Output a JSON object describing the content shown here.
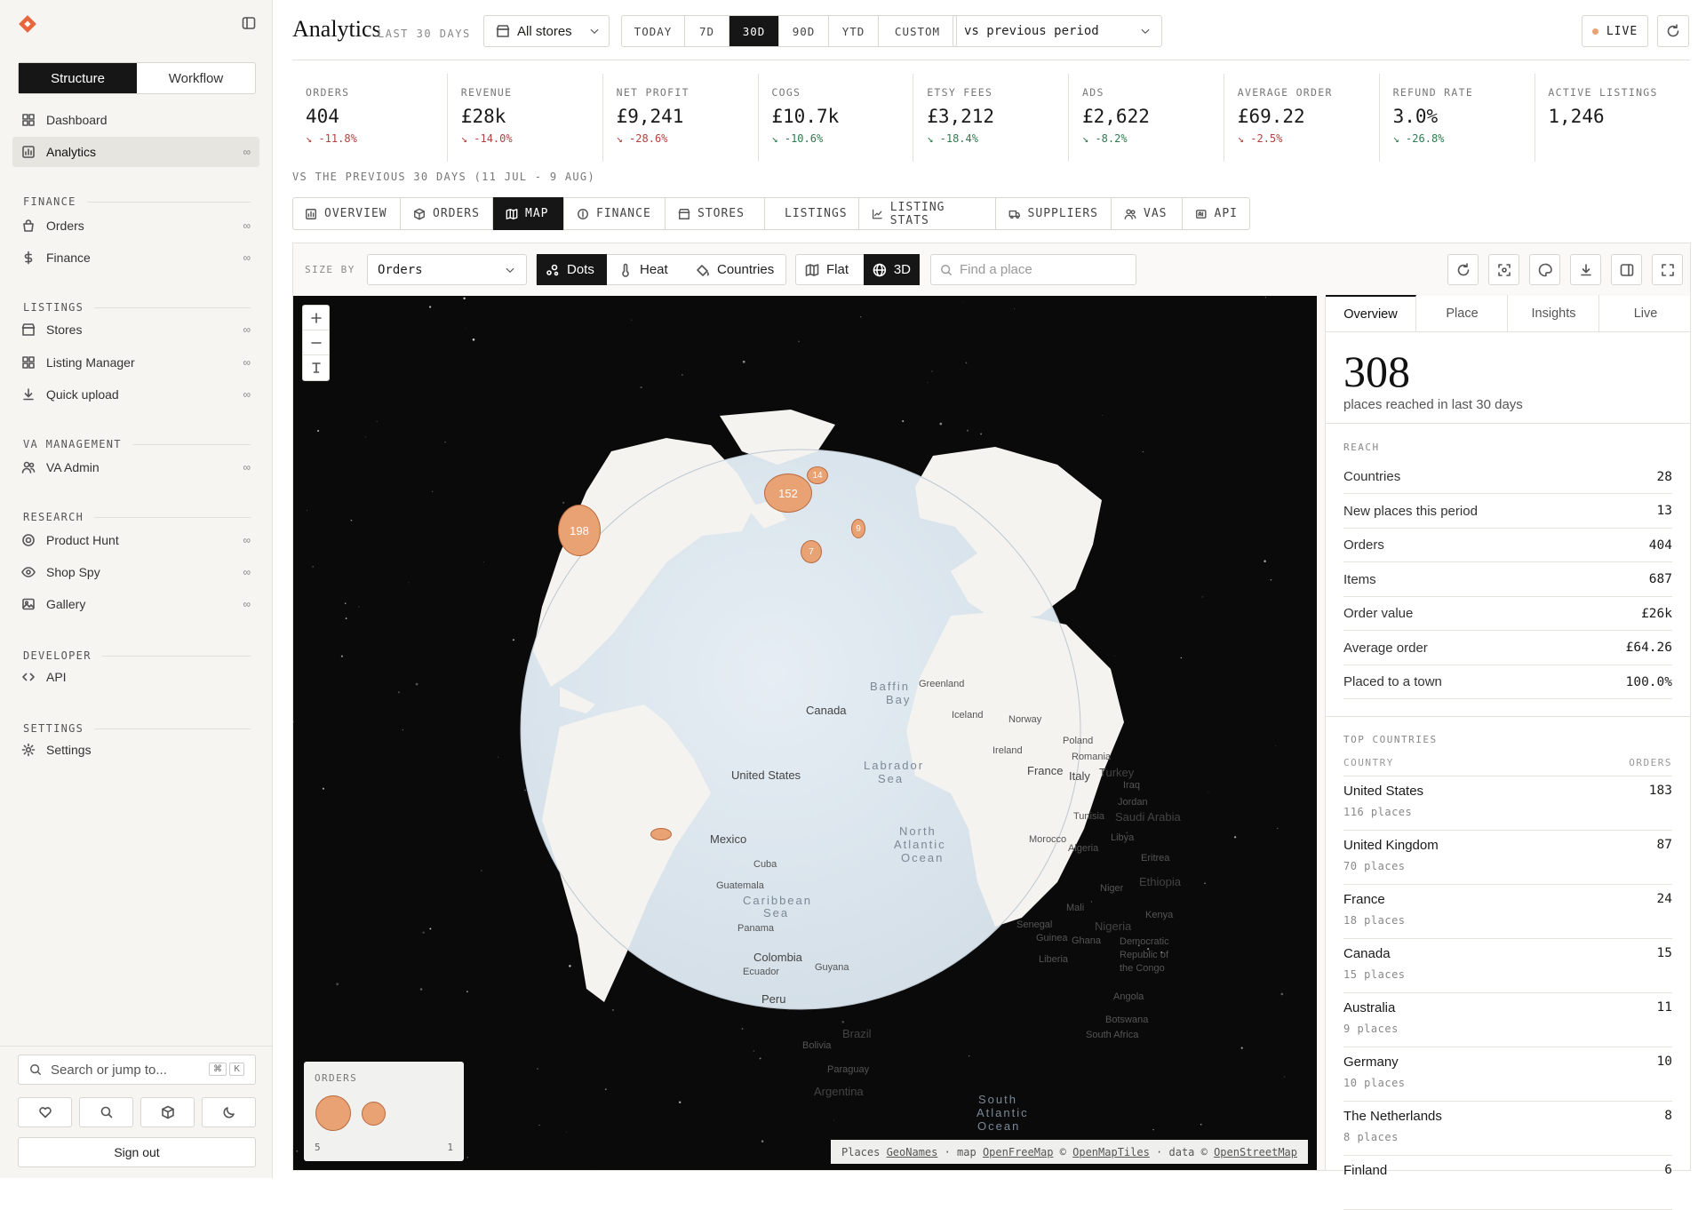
{
  "sidebar": {
    "mode_tabs": [
      "Structure",
      "Workflow"
    ],
    "top_items": [
      {
        "label": "Dashboard",
        "icon": "grid-icon"
      },
      {
        "label": "Analytics",
        "icon": "chart-icon",
        "badge": "∞",
        "active": true
      }
    ],
    "sections": [
      {
        "title": "FINANCE",
        "items": [
          {
            "label": "Orders",
            "icon": "bag-icon",
            "badge": "∞"
          },
          {
            "label": "Finance",
            "icon": "dollar-icon",
            "badge": "∞"
          }
        ]
      },
      {
        "title": "LISTINGS",
        "items": [
          {
            "label": "Stores",
            "icon": "store-icon",
            "badge": "∞"
          },
          {
            "label": "Listing Manager",
            "icon": "grid-icon",
            "badge": "∞"
          },
          {
            "label": "Quick upload",
            "icon": "download-icon",
            "badge": "∞"
          }
        ]
      },
      {
        "title": "VA MANAGEMENT",
        "items": [
          {
            "label": "VA Admin",
            "icon": "users-icon",
            "badge": "∞"
          }
        ]
      },
      {
        "title": "RESEARCH",
        "items": [
          {
            "label": "Product Hunt",
            "icon": "target-icon",
            "badge": "∞"
          },
          {
            "label": "Shop Spy",
            "icon": "eye-icon",
            "badge": "∞"
          },
          {
            "label": "Gallery",
            "icon": "image-icon",
            "badge": "∞"
          }
        ]
      },
      {
        "title": "DEVELOPER",
        "items": [
          {
            "label": "API",
            "icon": "code-icon"
          }
        ]
      },
      {
        "title": "SETTINGS",
        "items": [
          {
            "label": "Settings",
            "icon": "gear-icon"
          }
        ]
      }
    ],
    "search_placeholder": "Search or jump to...",
    "shortcut": [
      "⌘",
      "K"
    ],
    "signout": "Sign out"
  },
  "header": {
    "title": "Analytics",
    "subtitle": "LAST 30 DAYS",
    "store_select": "All stores",
    "ranges": [
      "TODAY",
      "7D",
      "30D",
      "90D",
      "YTD",
      "CUSTOM"
    ],
    "active_range": "30D",
    "compare": "vs previous period",
    "live": "LIVE"
  },
  "kpis": [
    {
      "label": "ORDERS",
      "value": "404",
      "delta": "↘ -11.8%",
      "dir": "up"
    },
    {
      "label": "REVENUE",
      "value": "£28k",
      "delta": "↘ -14.0%",
      "dir": "up"
    },
    {
      "label": "NET PROFIT",
      "value": "£9,241",
      "delta": "↘ -28.6%",
      "dir": "up"
    },
    {
      "label": "COGS",
      "value": "£10.7k",
      "delta": "↘ -10.6%",
      "dir": "down"
    },
    {
      "label": "ETSY FEES",
      "value": "£3,212",
      "delta": "↘ -18.4%",
      "dir": "down"
    },
    {
      "label": "ADS",
      "value": "£2,622",
      "delta": "↘ -8.2%",
      "dir": "down"
    },
    {
      "label": "AVERAGE ORDER",
      "value": "£69.22",
      "delta": "↘ -2.5%",
      "dir": "up"
    },
    {
      "label": "REFUND RATE",
      "value": "3.0%",
      "delta": "↘ -26.8%",
      "dir": "down"
    },
    {
      "label": "ACTIVE LISTINGS",
      "value": "1,246",
      "delta": "",
      "dir": "none"
    }
  ],
  "compare_note": "VS THE PREVIOUS 30 DAYS (11 JUL - 9 AUG)",
  "tabs": [
    "OVERVIEW",
    "ORDERS",
    "MAP",
    "FINANCE",
    "STORES",
    "LISTINGS",
    "LISTING STATS",
    "SUPPLIERS",
    "VAS",
    "API"
  ],
  "active_tab": "MAP",
  "map_toolbar": {
    "size_by_label": "SIZE BY",
    "size_by": "Orders",
    "modes": [
      "Dots",
      "Heat",
      "Countries"
    ],
    "active_mode": "Dots",
    "views": [
      "Flat",
      "3D"
    ],
    "active_view": "3D",
    "find_placeholder": "Find a place"
  },
  "map": {
    "bubbles": [
      {
        "label": "198"
      },
      {
        "label": "152"
      },
      {
        "label": "14"
      },
      {
        "label": "9"
      },
      {
        "label": "7"
      },
      {
        "label": ""
      }
    ],
    "place_labels": [
      "Baffin",
      "Bay",
      "Greenland",
      "Canada",
      "Iceland",
      "Norway",
      "Poland",
      "Ireland",
      "Romania",
      "France",
      "Italy",
      "Turkey",
      "Iraq",
      "Jordan",
      "Saudi Arabia",
      "United States",
      "Labrador",
      "Sea",
      "North",
      "Atlantic",
      "Ocean",
      "Mexico",
      "Cuba",
      "Guatemala",
      "Caribbean",
      "Sea",
      "Panama",
      "Colombia",
      "Ecuador",
      "Guyana",
      "Peru",
      "Brazil",
      "Bolivia",
      "Paraguay",
      "Argentina",
      "South",
      "Atlantic",
      "Ocean",
      "Morocco",
      "Algeria",
      "Tunisia",
      "Libya",
      "Eritrea",
      "Ethiopia",
      "Niger",
      "Mali",
      "Senegal",
      "Guinea",
      "Ghana",
      "Nigeria",
      "Liberia",
      "Kenya",
      "Democratic",
      "Republic of",
      "the Congo",
      "Angola",
      "Botswana",
      "South Africa"
    ],
    "legend": {
      "title": "ORDERS",
      "min": "5",
      "max": "1"
    },
    "attribution": [
      {
        "t": "Places "
      },
      {
        "t": "GeoNames",
        "u": true
      },
      {
        "t": " · map "
      },
      {
        "t": "OpenFreeMap",
        "u": true
      },
      {
        "t": " © "
      },
      {
        "t": "OpenMapTiles",
        "u": true
      },
      {
        "t": " · data © "
      },
      {
        "t": "OpenStreetMap",
        "u": true
      }
    ]
  },
  "panel": {
    "tabs": [
      "Overview",
      "Place",
      "Insights",
      "Live"
    ],
    "active_tab": "Overview",
    "big_number": "308",
    "big_caption": "places reached in last 30 days",
    "reach_title": "REACH",
    "reach": [
      {
        "label": "Countries",
        "value": "28"
      },
      {
        "label": "New places this period",
        "value": "13"
      },
      {
        "label": "Orders",
        "value": "404"
      },
      {
        "label": "Items",
        "value": "687"
      },
      {
        "label": "Order value",
        "value": "£26k"
      },
      {
        "label": "Average order",
        "value": "£64.26"
      },
      {
        "label": "Placed to a town",
        "value": "100.0%"
      }
    ],
    "top_title": "TOP COUNTRIES",
    "col_country": "COUNTRY",
    "col_orders": "ORDERS",
    "countries": [
      {
        "name": "United States",
        "places": "116 places",
        "orders": "183"
      },
      {
        "name": "United Kingdom",
        "places": "70 places",
        "orders": "87"
      },
      {
        "name": "France",
        "places": "18 places",
        "orders": "24"
      },
      {
        "name": "Canada",
        "places": "15 places",
        "orders": "15"
      },
      {
        "name": "Australia",
        "places": "9 places",
        "orders": "11"
      },
      {
        "name": "Germany",
        "places": "10 places",
        "orders": "10"
      },
      {
        "name": "The Netherlands",
        "places": "8 places",
        "orders": "8"
      },
      {
        "name": "Finland",
        "places": "",
        "orders": "6"
      }
    ]
  },
  "colors": {
    "accent": "#e9a273",
    "dark": "#161616",
    "negative": "#b0413e",
    "positive": "#2f7a4e",
    "logo": "#e8663c"
  }
}
